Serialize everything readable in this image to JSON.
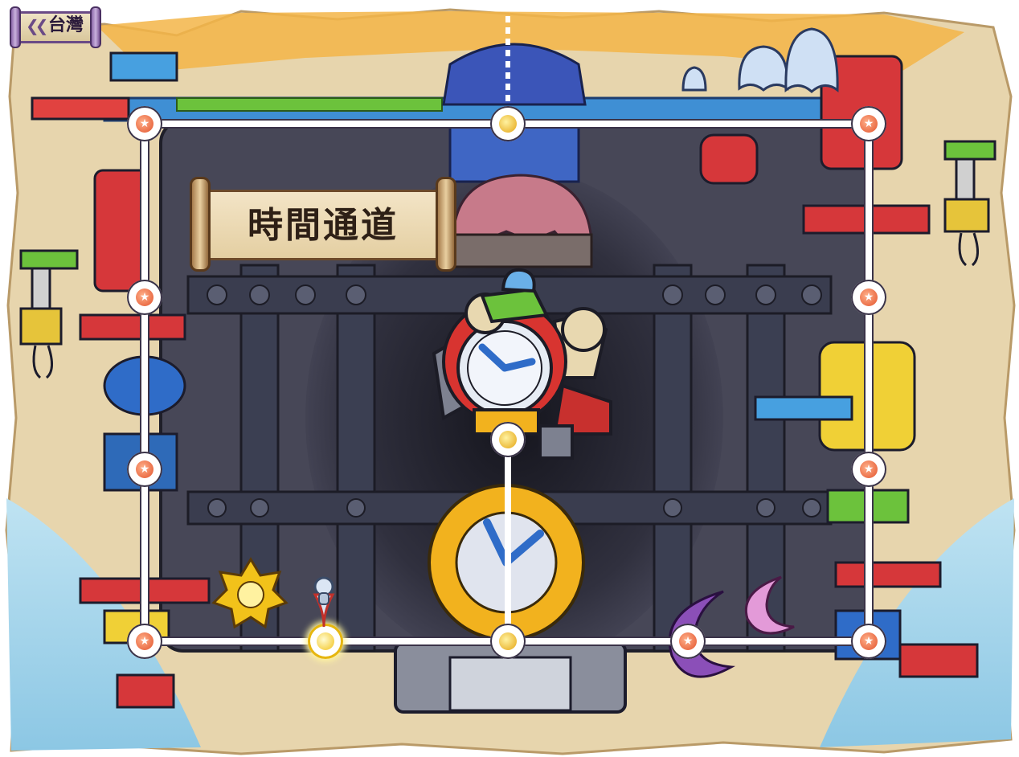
{
  "header": {
    "back_label": "台灣"
  },
  "map": {
    "title": "時間通道"
  },
  "nodes": [
    {
      "id": "top-left",
      "kind": "star"
    },
    {
      "id": "top-center",
      "kind": "gold"
    },
    {
      "id": "top-right",
      "kind": "star"
    },
    {
      "id": "left-upper",
      "kind": "star"
    },
    {
      "id": "right-upper",
      "kind": "star"
    },
    {
      "id": "left-lower",
      "kind": "star"
    },
    {
      "id": "center-middle",
      "kind": "gold"
    },
    {
      "id": "right-lower",
      "kind": "star"
    },
    {
      "id": "bottom-left",
      "kind": "star"
    },
    {
      "id": "bottom-current",
      "kind": "current"
    },
    {
      "id": "bottom-center",
      "kind": "gold"
    },
    {
      "id": "bottom-right-inner",
      "kind": "star"
    },
    {
      "id": "bottom-right",
      "kind": "star"
    }
  ],
  "icons": {
    "back": "double-chevron-left-icon",
    "location_marker": "player-location-icon"
  },
  "colors": {
    "sand": "#e8d7b2",
    "ocean": "#9fcfe8",
    "dark_metal": "#454556",
    "purple_frame": "#6a4a86",
    "route": "#ffffff",
    "star_node": "#e2532c",
    "gold_node": "#e4a412"
  }
}
